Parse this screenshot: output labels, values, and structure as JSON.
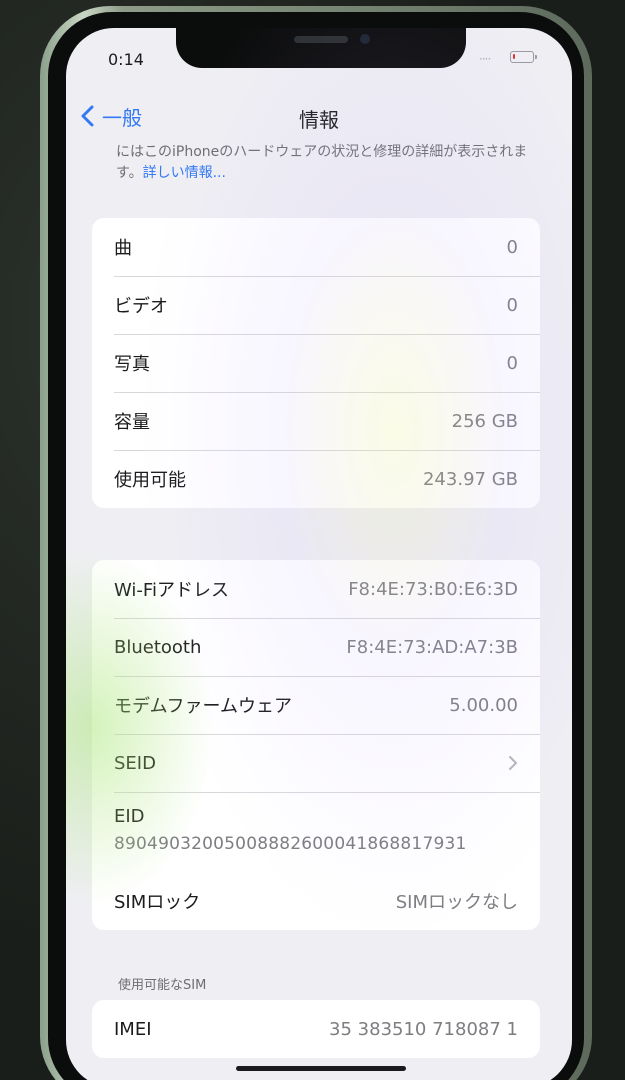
{
  "status_bar": {
    "time": "0:14",
    "signal": "····"
  },
  "nav": {
    "back_label": "一般",
    "title": "情報"
  },
  "intro": {
    "text": "にはこのiPhoneのハードウェアの状況と修理の詳細が表示されます。",
    "link": "詳しい情報..."
  },
  "media_section": {
    "rows": [
      {
        "label": "曲",
        "value": "0"
      },
      {
        "label": "ビデオ",
        "value": "0"
      },
      {
        "label": "写真",
        "value": "0"
      },
      {
        "label": "容量",
        "value": "256 GB"
      },
      {
        "label": "使用可能",
        "value": "243.97 GB"
      }
    ]
  },
  "network_section": {
    "wifi": {
      "label": "Wi-Fiアドレス",
      "value": "F8:4E:73:B0:E6:3D"
    },
    "bluetooth": {
      "label": "Bluetooth",
      "value": "F8:4E:73:AD:A7:3B"
    },
    "modem": {
      "label": "モデムファームウェア",
      "value": "5.00.00"
    },
    "seid": {
      "label": "SEID"
    },
    "eid": {
      "label": "EID",
      "value": "89049032005008882600041868817931"
    },
    "sim_lock": {
      "label": "SIMロック",
      "value": "SIMロックなし"
    }
  },
  "sim_section": {
    "header": "使用可能なSIM",
    "imei": {
      "label": "IMEI",
      "value": "35 383510 718087 1"
    }
  },
  "colors": {
    "accent": "#3478f6",
    "battery_low": "#e0302e",
    "background": "#efeff3"
  },
  "battery": {
    "level_percent": 12
  },
  "icons": {
    "back": "chevron-left-icon",
    "disclosure": "chevron-right-icon",
    "battery": "battery-icon"
  }
}
